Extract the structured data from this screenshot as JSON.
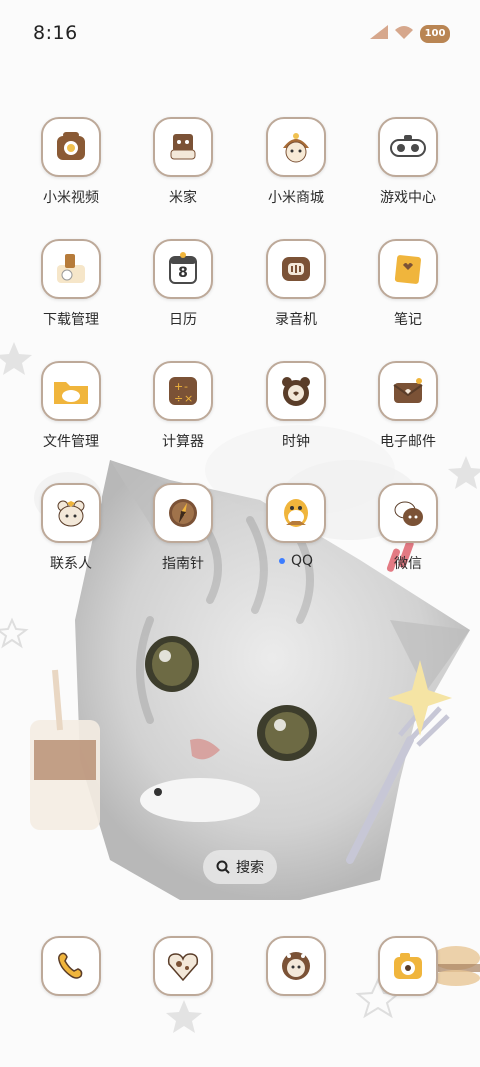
{
  "status_bar": {
    "time": "8:16",
    "battery": "100"
  },
  "apps": [
    {
      "label": "小米视频",
      "icon": "video-icon"
    },
    {
      "label": "米家",
      "icon": "home-device-icon"
    },
    {
      "label": "小米商城",
      "icon": "store-icon"
    },
    {
      "label": "游戏中心",
      "icon": "gamepad-icon"
    },
    {
      "label": "下载管理",
      "icon": "download-icon"
    },
    {
      "label": "日历",
      "icon": "calendar-icon",
      "calendar_day": "8"
    },
    {
      "label": "录音机",
      "icon": "recorder-icon"
    },
    {
      "label": "笔记",
      "icon": "notes-icon"
    },
    {
      "label": "文件管理",
      "icon": "folder-icon"
    },
    {
      "label": "计算器",
      "icon": "calculator-icon"
    },
    {
      "label": "时钟",
      "icon": "clock-icon"
    },
    {
      "label": "电子邮件",
      "icon": "mail-icon"
    },
    {
      "label": "联系人",
      "icon": "contacts-icon"
    },
    {
      "label": "指南针",
      "icon": "compass-icon"
    },
    {
      "label": "QQ",
      "icon": "qq-icon"
    },
    {
      "label": "微信",
      "icon": "wechat-icon"
    }
  ],
  "search": {
    "label": "搜索"
  },
  "dock": [
    {
      "icon": "phone-icon"
    },
    {
      "icon": "messages-icon"
    },
    {
      "icon": "browser-icon"
    },
    {
      "icon": "camera-icon"
    }
  ]
}
